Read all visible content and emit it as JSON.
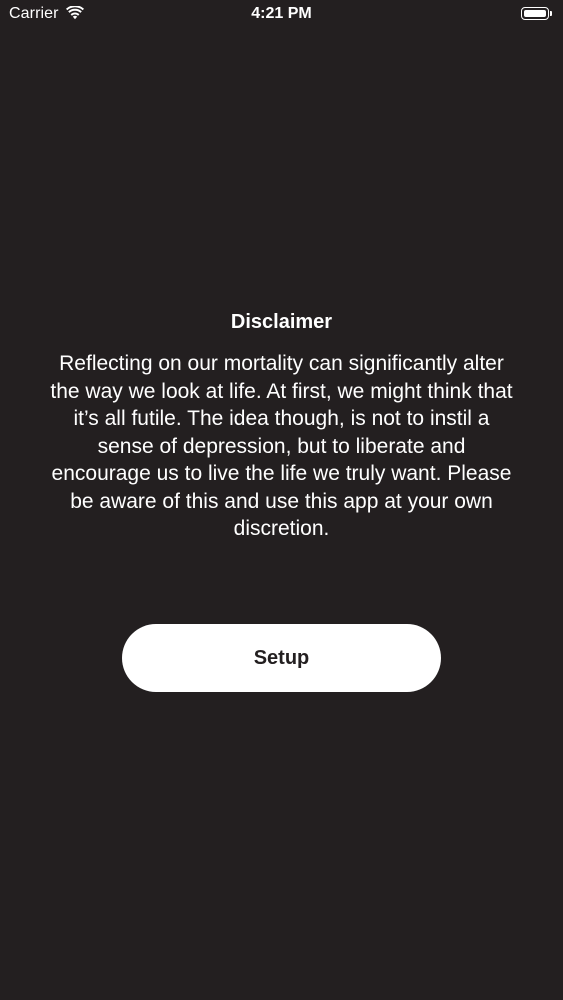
{
  "status_bar": {
    "carrier": "Carrier",
    "time": "4:21 PM",
    "icons": [
      "wifi-icon",
      "battery-icon"
    ]
  },
  "disclaimer": {
    "title": "Disclaimer",
    "body": "Reflecting on our mortality can significantly alter the way we look at life. At first, we might think that it’s all futile. The idea though, is not to instil a sense of depression, but to liberate and encourage us to live the life we truly want. Please be aware of this and use this app at your own discretion."
  },
  "actions": {
    "setup_label": "Setup"
  },
  "colors": {
    "background": "#231f20",
    "text": "#ffffff",
    "button_background": "#ffffff",
    "button_text": "#231f20"
  }
}
